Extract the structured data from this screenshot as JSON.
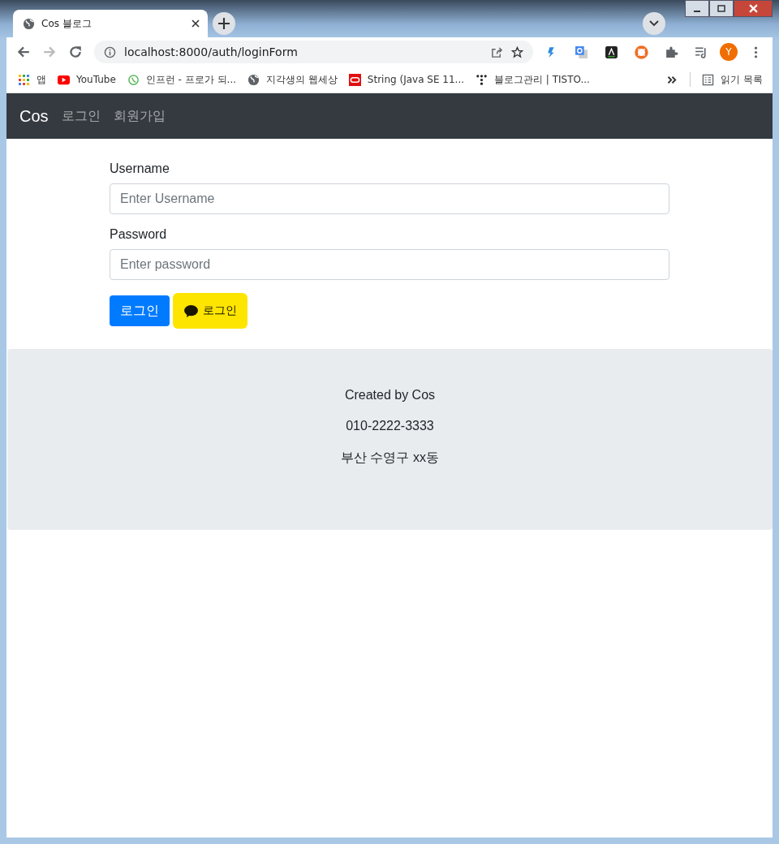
{
  "browser": {
    "tab": {
      "title": "Cos 블로그",
      "selected": true
    },
    "url": "localhost:8000/auth/loginForm",
    "profile": "Y",
    "bookmarks": [
      {
        "kind": "apps",
        "label": "앱"
      },
      {
        "kind": "youtube",
        "label": "YouTube"
      },
      {
        "kind": "inflearn",
        "label": "인프런 - 프로가 되..."
      },
      {
        "kind": "globe",
        "label": "지각생의 웹세상"
      },
      {
        "kind": "oracle",
        "label": "String (Java SE 11..."
      },
      {
        "kind": "tistory",
        "label": "블로그관리 | TISTO..."
      }
    ],
    "reading_list": "읽기 목록"
  },
  "navbar": {
    "brand": "Cos",
    "links": [
      "로그인",
      "회원가입"
    ]
  },
  "form": {
    "fields": [
      {
        "label": "Username",
        "placeholder": "Enter Username"
      },
      {
        "label": "Password",
        "placeholder": "Enter password"
      }
    ],
    "buttons": [
      {
        "kind": "primary",
        "label": "로그인"
      },
      {
        "kind": "kakao",
        "label": "로그인"
      }
    ]
  },
  "footer": {
    "lines": [
      "Created by Cos",
      "010-2222-3333",
      "부산 수영구 xx동"
    ]
  }
}
